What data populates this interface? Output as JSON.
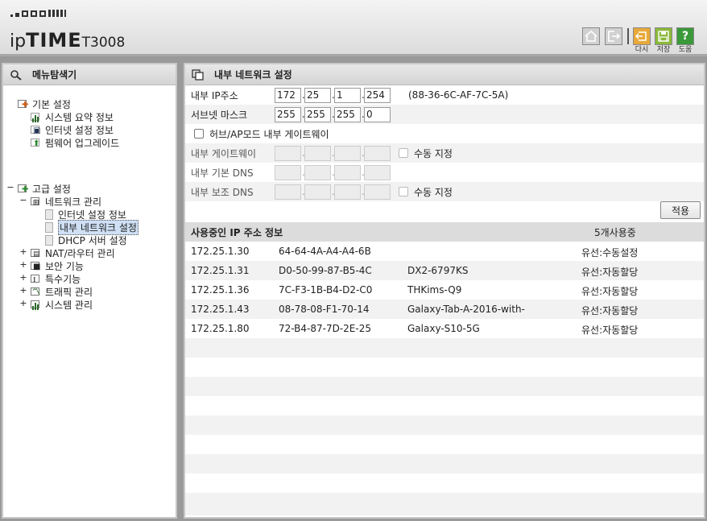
{
  "header": {
    "brand_prefix": "ip",
    "brand_main": "TIME",
    "model": "T3008",
    "buttons": [
      {
        "label": "다시",
        "icon": "undo-icon",
        "color": "#e8a93a"
      },
      {
        "label": "저장",
        "icon": "save-icon",
        "color": "#8ab83a"
      },
      {
        "label": "도움",
        "icon": "help-icon",
        "color": "#3a9a3a"
      }
    ]
  },
  "left": {
    "title": "메뉴탐색기",
    "tree": {
      "basic": "기본 설정",
      "basic_items": [
        "시스템 요약 정보",
        "인터넷 설정 정보",
        "펌웨어 업그레이드"
      ],
      "advanced": "고급 설정",
      "network": "네트워크 관리",
      "network_items": [
        "인터넷 설정 정보",
        "내부 네트워크 설정",
        "DHCP 서버 설정"
      ],
      "advanced_items": [
        "NAT/라우터 관리",
        "보안 기능",
        "특수기능",
        "트래픽 관리",
        "시스템 관리"
      ]
    }
  },
  "right": {
    "title": "내부 네트워크 설정",
    "form": {
      "ip_label": "내부 IP주소",
      "ip": [
        "172",
        "25",
        "1",
        "254"
      ],
      "mac": "(88-36-6C-AF-7C-5A)",
      "mask_label": "서브넷 마스크",
      "mask": [
        "255",
        "255",
        "255",
        "0"
      ],
      "hub_label": "허브/AP모드 내부 게이트웨이",
      "gw_label": "내부 게이트웨이",
      "manual_label": "수동 지정",
      "dns1_label": "내부 기본 DNS",
      "dns2_label": "내부 보조 DNS",
      "manual_label2": "수동 지정",
      "apply": "적용"
    },
    "iplist": {
      "title": "사용중인 IP 주소 정보",
      "count": "5개사용중",
      "rows": [
        {
          "ip": "172.25.1.30",
          "mac": "64-64-4A-A4-A4-6B",
          "name": "",
          "type": "유선:수동설정"
        },
        {
          "ip": "172.25.1.31",
          "mac": "D0-50-99-87-B5-4C",
          "name": "DX2-6797KS",
          "type": "유선:자동할당"
        },
        {
          "ip": "172.25.1.36",
          "mac": "7C-F3-1B-B4-D2-C0",
          "name": "THKims-Q9",
          "type": "유선:자동할당"
        },
        {
          "ip": "172.25.1.43",
          "mac": "08-78-08-F1-70-14",
          "name": "Galaxy-Tab-A-2016-with-",
          "type": "유선:자동할당"
        },
        {
          "ip": "172.25.1.80",
          "mac": "72-B4-87-7D-2E-25",
          "name": "Galaxy-S10-5G",
          "type": "유선:자동할당"
        }
      ]
    }
  }
}
